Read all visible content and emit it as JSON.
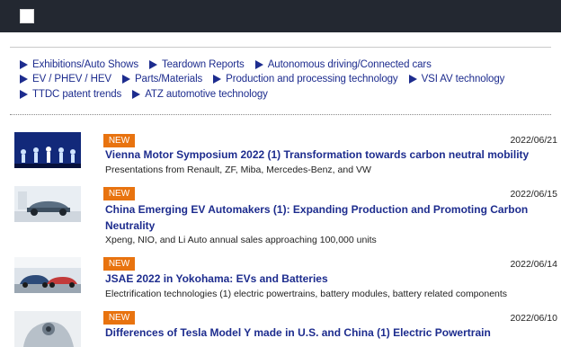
{
  "colors": {
    "topbar": "#232831",
    "link": "#1d2c8e",
    "badge": "#e8730f"
  },
  "header": {
    "menu_icon": "menu-square-icon"
  },
  "categories": {
    "row1": [
      "Exhibitions/Auto Shows",
      "Teardown Reports",
      "Autonomous driving/Connected cars"
    ],
    "row2": [
      "EV / PHEV / HEV",
      "Parts/Materials",
      "Production and processing technology",
      "VSI AV technology"
    ],
    "row3": [
      "TTDC patent trends",
      "ATZ automotive technology"
    ]
  },
  "articles": [
    {
      "badge": "NEW",
      "date": "2022/06/21",
      "title": "Vienna Motor Symposium 2022 (1) Transformation towards carbon neutral mobility",
      "description": "Presentations from Renault, ZF, Miba, Mercedes-Benz, and VW"
    },
    {
      "badge": "NEW",
      "date": "2022/06/15",
      "title": "China Emerging EV Automakers (1): Expanding Production and Promoting Carbon Neutrality",
      "description": "Xpeng, NIO, and Li Auto annual sales approaching 100,000 units"
    },
    {
      "badge": "NEW",
      "date": "2022/06/14",
      "title": "JSAE 2022 in Yokohama: EVs and Batteries",
      "description": "Electrification technologies (1) electric powertrains, battery modules, battery related components"
    },
    {
      "badge": "NEW",
      "date": "2022/06/10",
      "title": "Differences of Tesla Model Y made in U.S. and China (1) Electric Powertrain",
      "description": ""
    }
  ]
}
